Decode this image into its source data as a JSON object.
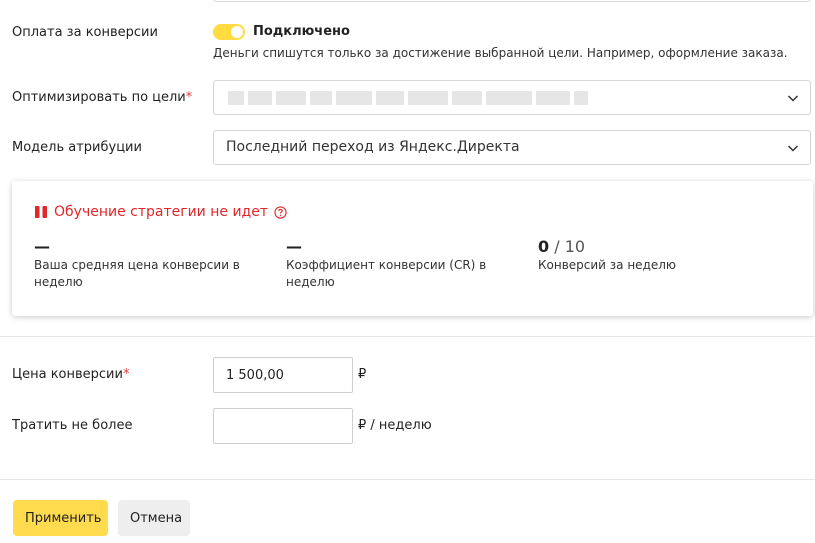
{
  "conversion_payment": {
    "label": "Оплата за конверсии",
    "toggle_state": "Подключено",
    "hint": "Деньги спишутся только за достижение выбранной цели. Например, оформление заказа."
  },
  "optimize_goal": {
    "label": "Оптимизировать по цели",
    "required_mark": "*"
  },
  "attribution": {
    "label": "Модель атрибуции",
    "value": "Последний переход из Яндекс.Директа"
  },
  "strategy_card": {
    "title": "Обучение стратегии не идет",
    "metrics": [
      {
        "value": "—",
        "caption": "Ваша средняя цена конверсии в неделю"
      },
      {
        "value": "—",
        "caption": "Коэффициент конверсии (CR) в неделю"
      },
      {
        "value": "0",
        "total": " / 10",
        "caption": "Конверсий за неделю"
      }
    ]
  },
  "conversion_price": {
    "label": "Цена конверсии",
    "required_mark": "*",
    "value": "1 500,00",
    "unit": "₽"
  },
  "spend_limit": {
    "label": "Тратить не более",
    "value": "",
    "unit": "₽ / неделю"
  },
  "actions": {
    "apply_label": "Применить",
    "cancel_label": "Отмена"
  },
  "colors": {
    "accent_yellow": "#ffdb4d",
    "error_red": "#e0272a",
    "required_red": "#e03c3c"
  }
}
